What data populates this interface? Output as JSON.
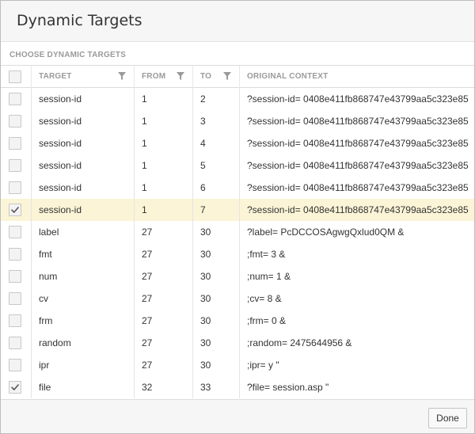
{
  "dialog": {
    "title": "Dynamic Targets",
    "section_label": "CHOOSE DYNAMIC TARGETS",
    "done_label": "Done"
  },
  "columns": {
    "target": "TARGET",
    "from": "FROM",
    "to": "TO",
    "context": "ORIGINAL CONTEXT"
  },
  "header_checked": false,
  "rows": [
    {
      "checked": false,
      "selected": false,
      "target": "session-id",
      "from": "1",
      "to": "2",
      "context": "?session-id= 0408e411fb868747e43799aa5c323e85"
    },
    {
      "checked": false,
      "selected": false,
      "target": "session-id",
      "from": "1",
      "to": "3",
      "context": "?session-id= 0408e411fb868747e43799aa5c323e85"
    },
    {
      "checked": false,
      "selected": false,
      "target": "session-id",
      "from": "1",
      "to": "4",
      "context": "?session-id= 0408e411fb868747e43799aa5c323e85"
    },
    {
      "checked": false,
      "selected": false,
      "target": "session-id",
      "from": "1",
      "to": "5",
      "context": "?session-id= 0408e411fb868747e43799aa5c323e85"
    },
    {
      "checked": false,
      "selected": false,
      "target": "session-id",
      "from": "1",
      "to": "6",
      "context": "?session-id= 0408e411fb868747e43799aa5c323e85"
    },
    {
      "checked": true,
      "selected": true,
      "target": "session-id",
      "from": "1",
      "to": "7",
      "context": "?session-id= 0408e411fb868747e43799aa5c323e85"
    },
    {
      "checked": false,
      "selected": false,
      "target": "label",
      "from": "27",
      "to": "30",
      "context": "?label= PcDCCOSAgwgQxlud0QM &"
    },
    {
      "checked": false,
      "selected": false,
      "target": "fmt",
      "from": "27",
      "to": "30",
      "context": ";fmt= 3 &"
    },
    {
      "checked": false,
      "selected": false,
      "target": "num",
      "from": "27",
      "to": "30",
      "context": ";num= 1 &"
    },
    {
      "checked": false,
      "selected": false,
      "target": "cv",
      "from": "27",
      "to": "30",
      "context": ";cv= 8 &"
    },
    {
      "checked": false,
      "selected": false,
      "target": "frm",
      "from": "27",
      "to": "30",
      "context": ";frm= 0 &"
    },
    {
      "checked": false,
      "selected": false,
      "target": "random",
      "from": "27",
      "to": "30",
      "context": ";random= 2475644956 &"
    },
    {
      "checked": false,
      "selected": false,
      "target": "ipr",
      "from": "27",
      "to": "30",
      "context": ";ipr= y \""
    },
    {
      "checked": true,
      "selected": false,
      "target": "file",
      "from": "32",
      "to": "33",
      "context": "?file= session.asp \""
    }
  ],
  "colors": {
    "selected_row": "#fbf4d6",
    "header_text": "#9a9a9a",
    "border": "#dcdcdc"
  },
  "icons": {
    "filter": "filter-icon",
    "check": "checkmark-icon"
  }
}
